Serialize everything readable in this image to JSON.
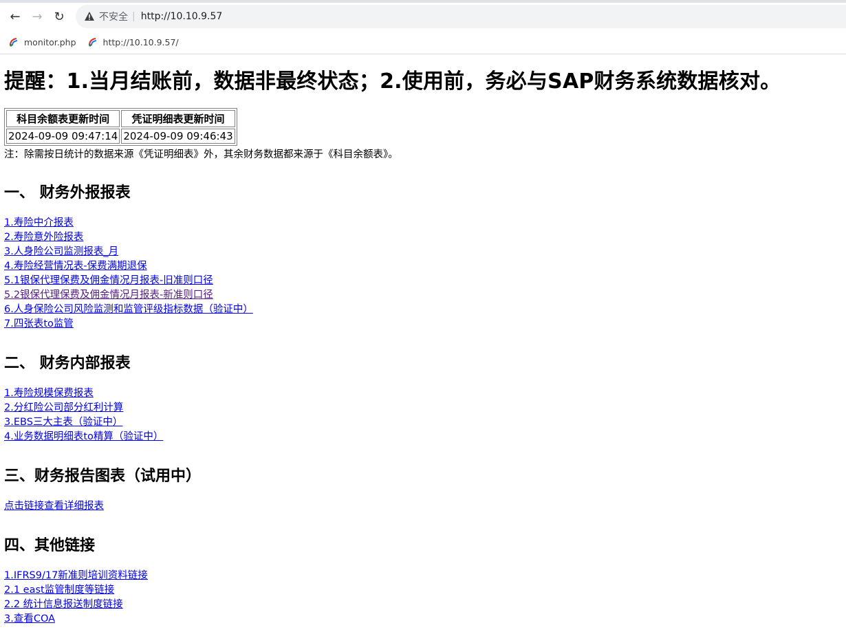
{
  "browser": {
    "insecure_label": "不安全",
    "url": "http://10.10.9.57",
    "bookmarks": [
      "monitor.php",
      "http://10.10.9.57/"
    ]
  },
  "page": {
    "reminder": "提醒：1.当月结账前，数据非最终状态；2.使用前，务必与SAP财务系统数据核对。",
    "update_table": {
      "headers": [
        "科目余额表更新时间",
        "凭证明细表更新时间"
      ],
      "values": [
        "2024-09-09 09:47:14",
        "2024-09-09 09:46:43"
      ]
    },
    "note": "注：除需按日统计的数据来源《凭证明细表》外，其余财务数据都来源于《科目余额表》。",
    "sections": [
      {
        "title": "一、 财务外报报表",
        "links": [
          "1.寿险中介报表",
          "2.寿险意外险报表",
          "3.人身险公司监测报表_月",
          "4.寿险经营情况表-保费满期退保",
          "5.1银保代理保费及佣金情况月报表-旧准则口径",
          "5.2银保代理保费及佣金情况月报表-新准则口径",
          "6.人身保险公司风险监测和监管评级指标数据（验证中）",
          "7.四张表to监管"
        ]
      },
      {
        "title": "二、 财务内部报表",
        "links": [
          "1.寿险规模保费报表",
          "2.分红险公司部分红利计算",
          "3.EBS三大主表（验证中）",
          "4.业务数据明细表to精算（验证中）"
        ]
      },
      {
        "title": "三、财务报告图表（试用中）",
        "links": [
          "点击链接查看详细报表"
        ]
      },
      {
        "title": "四、其他链接",
        "links": [
          "1.IFRS9/17新准则培训资料链接",
          "2.1 east监管制度等链接",
          "2.2 统计信息报送制度链接",
          "3.查看COA"
        ]
      }
    ]
  }
}
